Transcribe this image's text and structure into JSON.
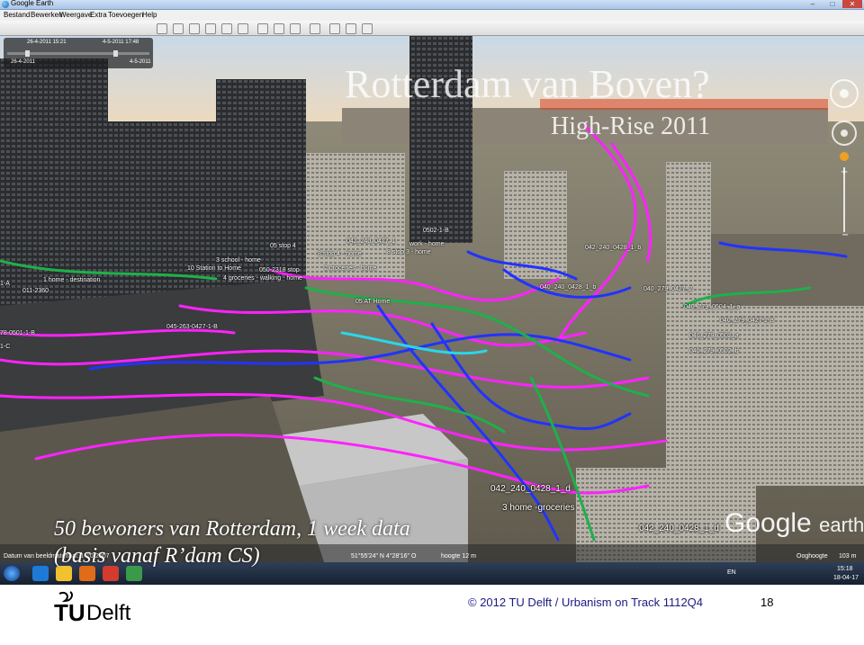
{
  "window": {
    "title": "Google Earth",
    "menu": [
      "Bestand",
      "Bewerken",
      "Weergave",
      "Extra",
      "Toevoegen",
      "Help"
    ]
  },
  "slide": {
    "title": "Rotterdam van Boven?",
    "subtitle": "High-Rise 2011",
    "caption_line1": "50 bewoners van Rotterdam, 1 week data",
    "caption_line2": "(basis vanaf R’dam CS)",
    "footer_copyright": "© 2012 TU Delft / Urbanism on Track 1112Q4",
    "page_number": "18",
    "logo_tu": "TU",
    "logo_delft": "Delft"
  },
  "timeslider": {
    "start_top": "26-4-2011 15:21",
    "end_top": "4-5-2011 17:48",
    "start_bottom": "26-4-2011",
    "end_bottom": "4-5-2011"
  },
  "map": {
    "brand": "Google",
    "brand_suffix": "earth",
    "labels": [
      "1 home - destination",
      "10 Station to Home",
      "2 groceries - home",
      "05 AT Home",
      "045-263-0427-1-B",
      "042_240_0428_1_d",
      "3 home -groceries",
      "042_240_0428_1_d",
      "050-2318 stop",
      "4 groceries - walking - home",
      "8 stop 4 - home",
      "8 stop 3 - home",
      "work - home",
      "040_279_0427_2",
      "040_279_0504_1_a",
      "040_279_0427-1-B",
      "040_279_0502_a",
      "040_279_0502_b",
      "040_240_0428_1_b",
      "011-2360",
      "1-A",
      "1-C",
      "78-0501-1-B",
      "3 school - home",
      "05 stop 4",
      "0502-1-B",
      "042_240_0428_1_b",
      "042_240_0427_1"
    ]
  },
  "statusbar": {
    "date": "Datum van beeldmateriaal: 1-10-2007",
    "coords": "51°55'24\" N  4°28'16\" O",
    "elev": "hoogte 12 m",
    "eye": "Ooghoogte",
    "eye_val": "103 m"
  },
  "taskbar": {
    "lang": "EN",
    "time": "15:18",
    "date": "18-04-17"
  },
  "colors": {
    "magenta": "#ff22ff",
    "blue": "#2233ff",
    "green": "#1fb04a",
    "cyan": "#2ad6e8"
  }
}
